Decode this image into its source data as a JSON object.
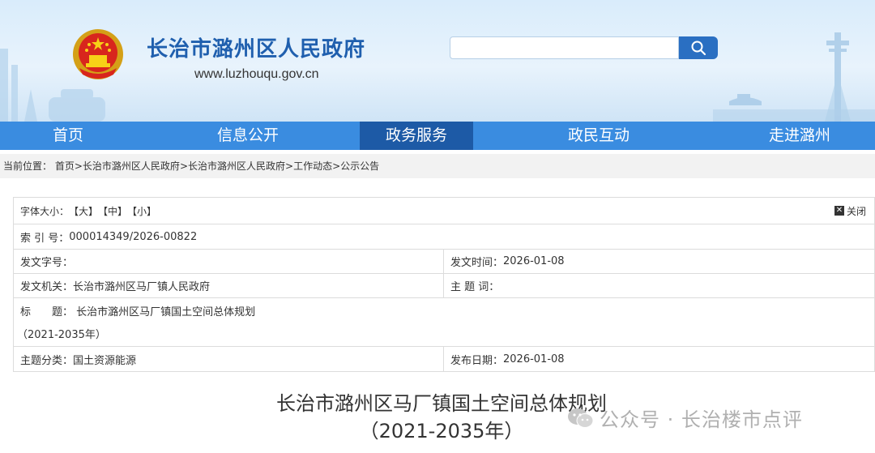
{
  "header": {
    "site_title": "长治市潞州区人民政府",
    "site_url": "www.luzhouqu.gov.cn",
    "search": {
      "value": "",
      "placeholder": ""
    }
  },
  "nav": {
    "items": [
      {
        "label": "首页"
      },
      {
        "label": "信息公开"
      },
      {
        "label": "政务服务"
      },
      {
        "label": "政民互动"
      },
      {
        "label": "走进潞州"
      }
    ],
    "active_index": 2
  },
  "breadcrumb": {
    "prefix": "当前位置：",
    "items": [
      "首页",
      "长治市潞州区人民政府",
      "长治市潞州区人民政府",
      "工作动态",
      "公示公告"
    ],
    "separator": ">"
  },
  "info": {
    "font_size_label": "字体大小：",
    "font_large": "【大】",
    "font_medium": "【中】",
    "font_small": "【小】",
    "close_label": "关闭",
    "index_label": "索 引 号：",
    "index_value": "000014349/2026-00822",
    "doc_no_label": "发文字号：",
    "doc_no_value": "",
    "issue_time_label": "发文时间：",
    "issue_time_value": "2026-01-08",
    "org_label": "发文机关：",
    "org_value": "长治市潞州区马厂镇人民政府",
    "keywords_label": "主 题 词：",
    "keywords_value": "",
    "title_label": "标　　题：",
    "title_value": "长治市潞州区马厂镇国土空间总体规划",
    "title_value_2": "（2021-2035年）",
    "category_label": "主题分类：",
    "category_value": "国土资源能源",
    "publish_date_label": "发布日期：",
    "publish_date_value": "2026-01-08"
  },
  "article": {
    "title": "长治市潞州区马厂镇国土空间总体规划",
    "subtitle": "（2021-2035年）"
  },
  "watermark": {
    "text": "公众号 · 长治楼市点评"
  },
  "colors": {
    "brand_blue": "#1f5fae",
    "nav_blue": "#3a8ce0",
    "nav_active": "#1d5aa6"
  }
}
